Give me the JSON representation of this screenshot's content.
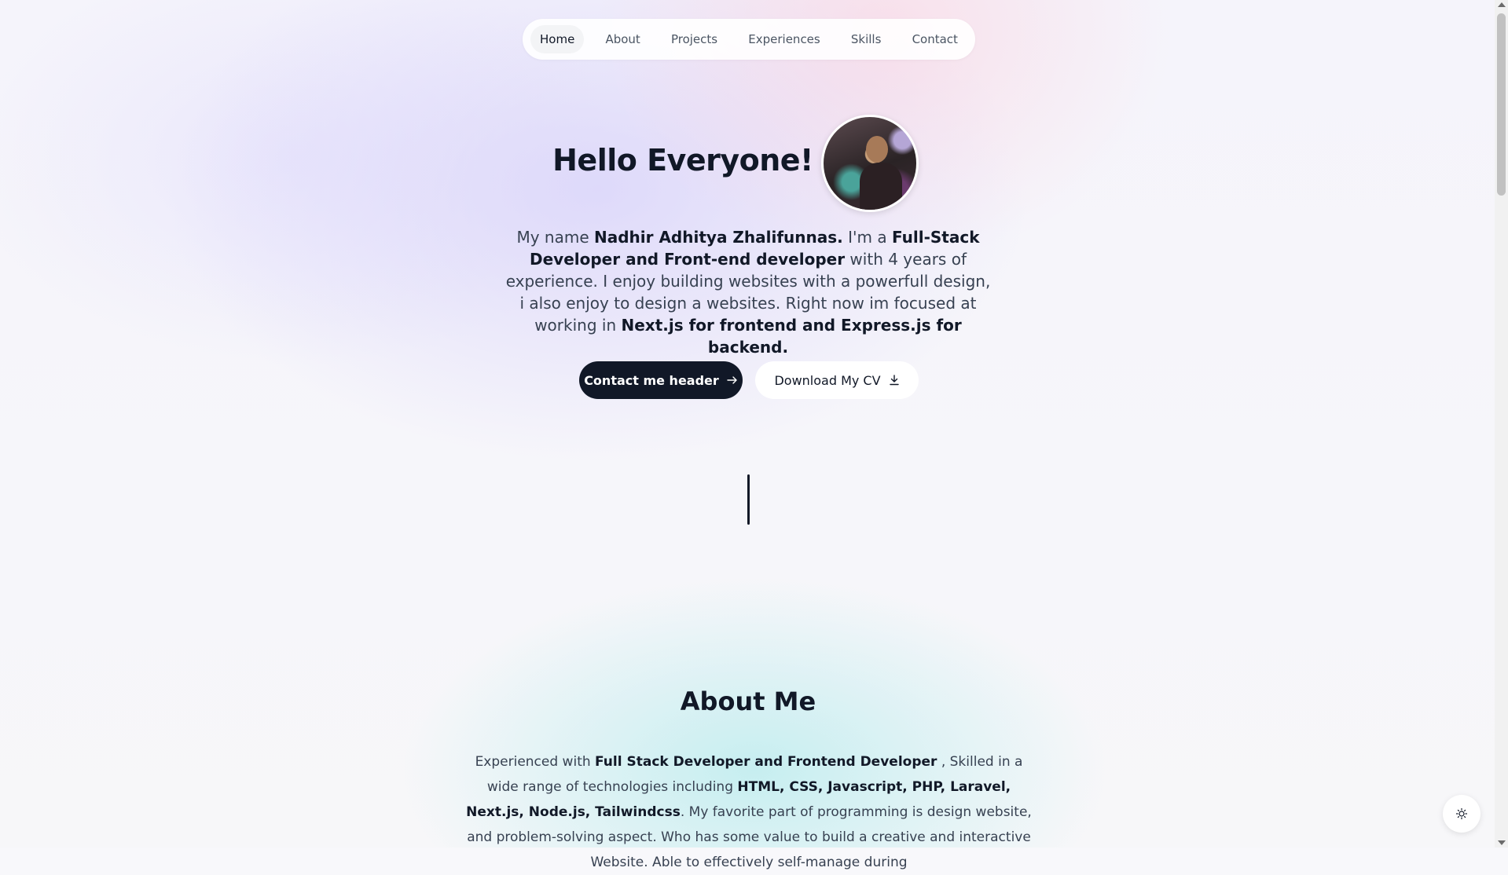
{
  "nav": {
    "items": [
      {
        "label": "Home",
        "active": true
      },
      {
        "label": "About",
        "active": false
      },
      {
        "label": "Projects",
        "active": false
      },
      {
        "label": "Experiences",
        "active": false
      },
      {
        "label": "Skills",
        "active": false
      },
      {
        "label": "Contact",
        "active": false
      }
    ]
  },
  "hero": {
    "title": "Hello Everyone!",
    "intro": {
      "t1": "My name ",
      "b1": "Nadhir Adhitya Zhalifunnas.",
      "t2": " I'm a ",
      "b2": "Full-Stack Developer and Front-end developer",
      "t3": " with 4 years of experience. I enjoy building websites with a powerfull design, i also enjoy to design a websites. Right now im focused at working in ",
      "b3": "Next.js for frontend and Express.js for backend."
    },
    "primary_button": "Contact me header",
    "secondary_button": "Download My CV"
  },
  "about": {
    "title": "About Me",
    "text": {
      "t1": "Experienced with ",
      "b1": "Full Stack Developer and Frontend Developer",
      "t2": " , Skilled in a wide range of technologies including ",
      "b2": "HTML, CSS, Javascript, PHP, Laravel, Next.js, Node.js, Tailwindcss",
      "t3": ". My favorite part of programming is design website, and problem-solving aspect. Who has some value to build a creative and interactive Website. Able to effectively self-manage during"
    }
  },
  "icons": {
    "primary_button_icon": "arrow-right-icon",
    "secondary_button_icon": "download-icon",
    "theme_toggle_icon": "sun-icon"
  },
  "colors": {
    "dark": "#111827",
    "text": "#374151",
    "nav_inactive": "#4b5563",
    "surface": "#ffffff"
  }
}
